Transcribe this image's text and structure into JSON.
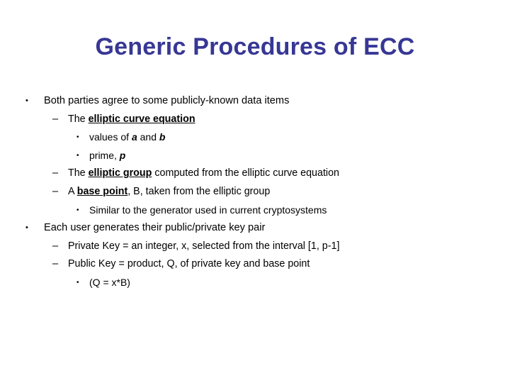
{
  "slide": {
    "background_color": "#ffffff",
    "title": "Generic Procedures of ECC",
    "title_color": "#373795",
    "body_color": "#000000",
    "markers": {
      "level1": "•",
      "level2": "–",
      "level3": "•"
    },
    "bullets": [
      {
        "level": 1,
        "marker": "•",
        "text": "Both parties agree to some publicly-known data items",
        "runs": [
          {
            "t": "Both parties agree to some publicly-known data items",
            "s": "plain"
          }
        ]
      },
      {
        "level": 2,
        "marker": "–",
        "text": "The elliptic curve equation",
        "runs": [
          {
            "t": "The ",
            "s": "plain"
          },
          {
            "t": "elliptic curve equation",
            "s": "bold-underline"
          }
        ]
      },
      {
        "level": 3,
        "marker": "•",
        "text": "values of a and b",
        "runs": [
          {
            "t": "values of ",
            "s": "plain"
          },
          {
            "t": "a",
            "s": "bold-italic"
          },
          {
            "t": " and ",
            "s": "plain"
          },
          {
            "t": "b",
            "s": "bold-italic"
          }
        ]
      },
      {
        "level": 3,
        "marker": "•",
        "text": "prime, p",
        "runs": [
          {
            "t": "prime, ",
            "s": "plain"
          },
          {
            "t": "p",
            "s": "bold-italic"
          }
        ]
      },
      {
        "level": 2,
        "marker": "–",
        "text": "The elliptic group computed from the elliptic curve equation",
        "runs": [
          {
            "t": "The ",
            "s": "plain"
          },
          {
            "t": "elliptic group",
            "s": "bold-underline"
          },
          {
            "t": " computed from the elliptic curve equation",
            "s": "plain"
          }
        ]
      },
      {
        "level": 2,
        "marker": "–",
        "text": "A base point, B, taken from the elliptic group",
        "runs": [
          {
            "t": "A ",
            "s": "plain"
          },
          {
            "t": "base point",
            "s": "bold-underline"
          },
          {
            "t": ", B, taken from the elliptic group",
            "s": "plain"
          }
        ]
      },
      {
        "level": 3,
        "marker": "•",
        "text": "Similar to the generator used in current cryptosystems",
        "runs": [
          {
            "t": "Similar to the generator used in current cryptosystems",
            "s": "plain"
          }
        ]
      },
      {
        "level": 1,
        "marker": "•",
        "text": "Each user generates their public/private key pair",
        "runs": [
          {
            "t": "Each user generates their public/private key pair",
            "s": "plain"
          }
        ]
      },
      {
        "level": 2,
        "marker": "–",
        "text": "Private Key = an integer, x, selected from the interval [1, p-1]",
        "runs": [
          {
            "t": "Private Key = an integer, x, selected from the interval [1, p-1]",
            "s": "plain"
          }
        ]
      },
      {
        "level": 2,
        "marker": "–",
        "text": "Public Key = product, Q, of private key and base point",
        "runs": [
          {
            "t": "Public Key = product, Q, of private key and base point",
            "s": "plain"
          }
        ]
      },
      {
        "level": 3,
        "marker": "•",
        "text": "(Q = x*B)",
        "runs": [
          {
            "t": "(Q = x*B)",
            "s": "plain"
          }
        ]
      }
    ]
  }
}
